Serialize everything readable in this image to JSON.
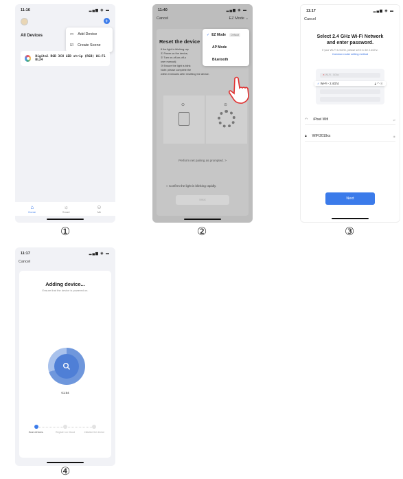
{
  "labels": {
    "p1": "①",
    "p2": "②",
    "p3": "③",
    "p4": "④"
  },
  "phone1": {
    "time": "11:16",
    "title": "All Devices",
    "menu": [
      {
        "label": "Add Device",
        "icon": "add-device-icon"
      },
      {
        "label": "Create Scene",
        "icon": "create-scene-icon"
      }
    ],
    "device_name": "Digital RGB 3CH LED strip (RGB) Wi-Fi BL24",
    "tabs": [
      {
        "label": "Home",
        "icon": "home-icon"
      },
      {
        "label": "Smart",
        "icon": "smart-icon"
      },
      {
        "label": "Me",
        "icon": "me-icon"
      }
    ]
  },
  "phone2": {
    "time": "11:40",
    "cancel": "Cancel",
    "mode": "EZ Mode",
    "title": "Reset the device",
    "instructions": [
      "If the light is blinking rap",
      "① Power on the device,",
      "② Turn on-off-on-off-o",
      "user manual);",
      "③ Ensure the light is blink",
      "Note: please complete the",
      "within 3 minutes after resetting the device."
    ],
    "mode_options": [
      {
        "label": "EZ Mode",
        "tag": "Default",
        "selected": true
      },
      {
        "label": "AP Mode",
        "tag": "",
        "selected": false
      },
      {
        "label": "Bluetooth",
        "tag": "",
        "selected": false
      }
    ],
    "perform": "Perform net pairing as prompted. >",
    "confirm": "Confirm the light is blinking rapidly.",
    "next": "Next"
  },
  "phone3": {
    "time": "11:17",
    "cancel": "Cancel",
    "title_line1": "Select 2.4 GHz Wi-Fi Network",
    "title_line2": "and enter password.",
    "subtitle": "If your Wi-Fi is 5GHz, please set it to be 2.4GHz.",
    "link": "Common router setting method",
    "wifi_5g": "Wi-Fi - 5Ghz",
    "wifi_24g": "Wi-Fi - 2.4Ghz",
    "network": "iPixel Wifi",
    "password": "WIFI2019xs",
    "next": "Next"
  },
  "phone4": {
    "time": "11:17",
    "cancel": "Cancel",
    "title": "Adding device...",
    "subtitle": "Ensure that the device is powered on.",
    "timer": "01:54",
    "steps": [
      {
        "label": "Scan devices.",
        "active": true
      },
      {
        "label": "Register on Cloud",
        "active": false
      },
      {
        "label": "Initialize the device",
        "active": false
      }
    ]
  }
}
